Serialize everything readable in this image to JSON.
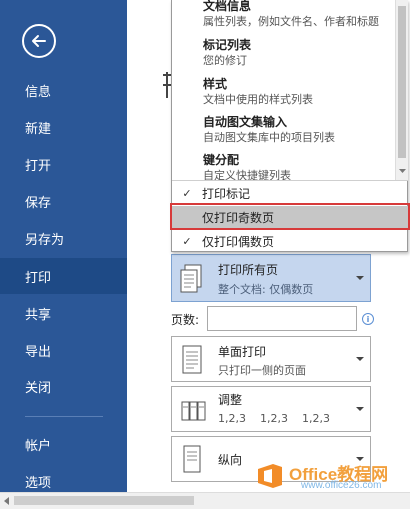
{
  "sidebar": {
    "items": [
      {
        "label": "信息"
      },
      {
        "label": "新建"
      },
      {
        "label": "打开"
      },
      {
        "label": "保存"
      },
      {
        "label": "另存为"
      },
      {
        "label": "打印"
      },
      {
        "label": "共享"
      },
      {
        "label": "导出"
      },
      {
        "label": "关闭"
      },
      {
        "label": "帐户"
      },
      {
        "label": "选项"
      }
    ],
    "active": "打印"
  },
  "popup": {
    "entries": [
      {
        "title": "文档信息",
        "desc": "属性列表，例如文件名、作者和标题"
      },
      {
        "title": "标记列表",
        "desc": "您的修订"
      },
      {
        "title": "样式",
        "desc": "文档中使用的样式列表"
      },
      {
        "title": "自动图文集输入",
        "desc": "自动图文集库中的项目列表"
      },
      {
        "title": "键分配",
        "desc": "自定义快捷键列表"
      }
    ],
    "options": [
      {
        "label": "打印标记",
        "checked": true
      },
      {
        "label": "仅打印奇数页",
        "checked": false,
        "highlighted": true
      },
      {
        "label": "仅打印偶数页",
        "checked": true
      }
    ]
  },
  "print_settings": {
    "range": {
      "main": "打印所有页",
      "sub": "整个文档: 仅偶数页"
    },
    "pages_label": "页数:",
    "pages_value": "",
    "sides": {
      "main": "单面打印",
      "sub": "只打印一侧的页面"
    },
    "collate": {
      "main": "调整",
      "sub": "1,2,3    1,2,3    1,2,3"
    },
    "orientation": {
      "main": "纵向"
    }
  },
  "watermark": {
    "brand": "Office",
    "brand_cn": "教程网",
    "url": "www.office26.com"
  },
  "colors": {
    "sidebar": "#2b5797",
    "sidebar_active": "#1e4a86",
    "selected_box": "#c5d6ee",
    "highlight_frame": "#d73a3a",
    "watermark_orange": "#f2a03d"
  }
}
